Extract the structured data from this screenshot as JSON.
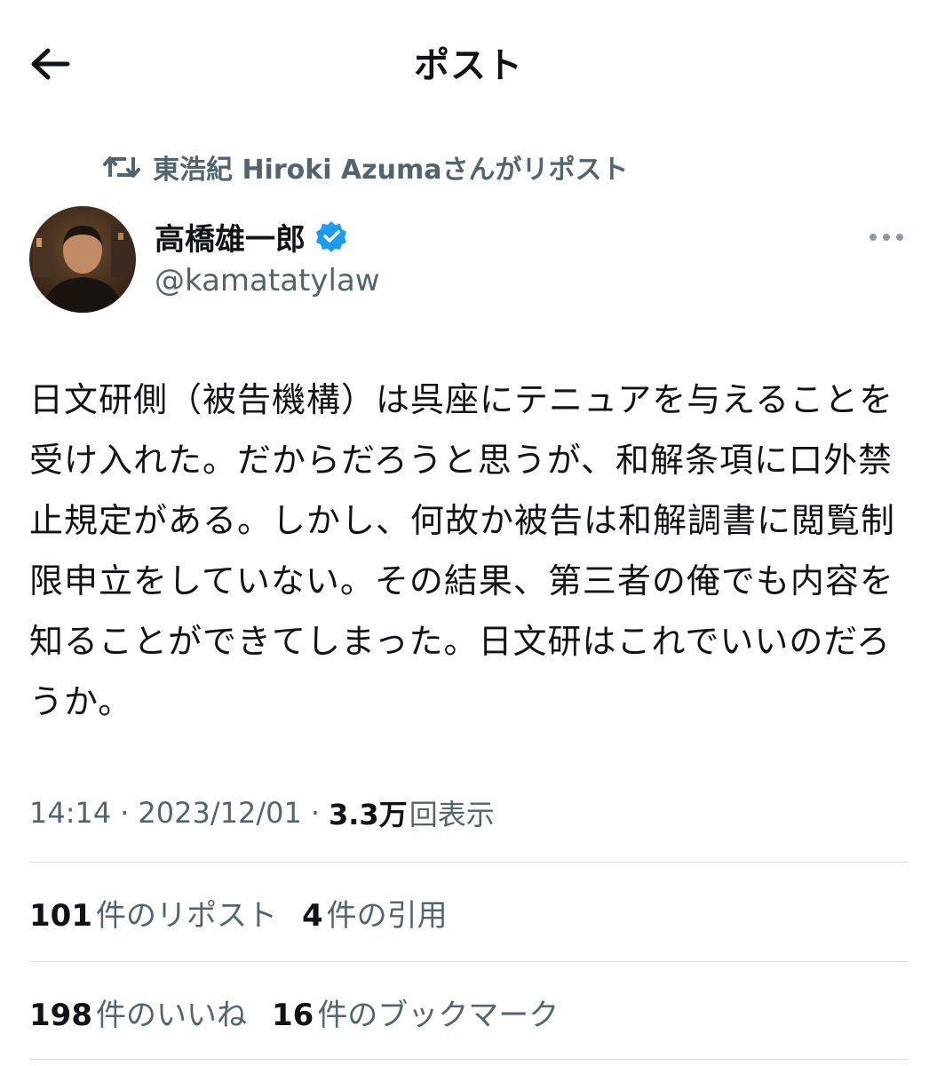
{
  "header": {
    "title": "ポスト"
  },
  "repost": {
    "label": "東浩紀 Hiroki Azumaさんがリポスト"
  },
  "author": {
    "name": "高橋雄一郎",
    "handle": "@kamatatylaw",
    "verified": true
  },
  "post": {
    "text": "日文研側（被告機構）は呉座にテニュアを与えることを受け入れた。だからだろうと思うが、和解条項に口外禁止規定がある。しかし、何故か被告は和解調書に閲覧制限申立をしていない。その結果、第三者の俺でも内容を知ることができてしまった。日文研はこれでいいのだろうか。"
  },
  "meta": {
    "time": "14:14",
    "separator": "·",
    "date": "2023/12/01",
    "views_count": "3.3万",
    "views_label": "回表示"
  },
  "stats": {
    "reposts_count": "101",
    "reposts_label": "件のリポスト",
    "quotes_count": "4",
    "quotes_label": "件の引用",
    "likes_count": "198",
    "likes_label": "件のいいね",
    "bookmarks_count": "16",
    "bookmarks_label": "件のブックマーク"
  },
  "colors": {
    "text_primary": "#0f1419",
    "text_secondary": "#536471",
    "verified_blue": "#1d9bf0",
    "divider": "#d8dde1"
  },
  "icons": {
    "back": "arrow-left-icon",
    "repost": "repost-icon",
    "verified": "verified-badge-icon",
    "more": "more-dots-icon"
  }
}
